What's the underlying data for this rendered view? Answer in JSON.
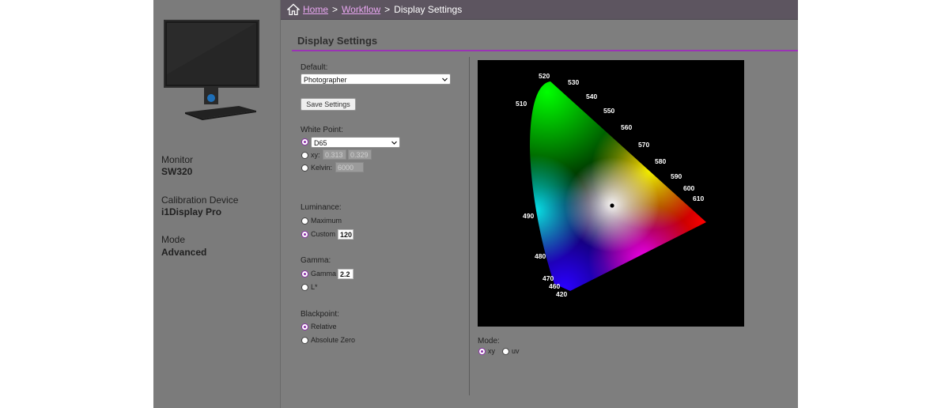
{
  "breadcrumb": {
    "home": "Home",
    "workflow": "Workflow",
    "current": "Display Settings",
    "separator": ">"
  },
  "page": {
    "title": "Display Settings"
  },
  "sidebar": {
    "monitor_label": "Monitor",
    "monitor_value": "SW320",
    "device_label": "Calibration Device",
    "device_value": "i1Display Pro",
    "mode_label": "Mode",
    "mode_value": "Advanced"
  },
  "settings": {
    "default_label": "Default:",
    "default_value": "Photographer",
    "save_button": "Save Settings",
    "white_point": {
      "label": "White Point:",
      "preset_value": "D65",
      "xy_label": "xy:",
      "x_value": "0.313",
      "y_value": "0.329",
      "kelvin_label": "Kelvin:",
      "kelvin_value": "6000",
      "selected": "preset"
    },
    "luminance": {
      "label": "Luminance:",
      "maximum_label": "Maximum",
      "custom_label": "Custom",
      "custom_value": "120",
      "selected": "custom"
    },
    "gamma": {
      "label": "Gamma:",
      "gamma_label": "Gamma",
      "gamma_value": "2.2",
      "lstar_label": "L*",
      "selected": "gamma"
    },
    "blackpoint": {
      "label": "Blackpoint:",
      "relative_label": "Relative",
      "absolute_label": "Absolute Zero",
      "selected": "relative"
    }
  },
  "diagram": {
    "wavelength_labels": [
      "520",
      "530",
      "540",
      "550",
      "560",
      "570",
      "580",
      "590",
      "600",
      "610",
      "510",
      "490",
      "480",
      "470",
      "460",
      "420"
    ]
  },
  "mode": {
    "label": "Mode:",
    "xy_label": "xy",
    "uv_label": "uv",
    "selected": "xy"
  },
  "colors": {
    "accent": "#9b33b5",
    "breadcrumb_bg": "#5d5560",
    "link": "#e8a6f0",
    "panel_bg": "#7e7e7e"
  }
}
